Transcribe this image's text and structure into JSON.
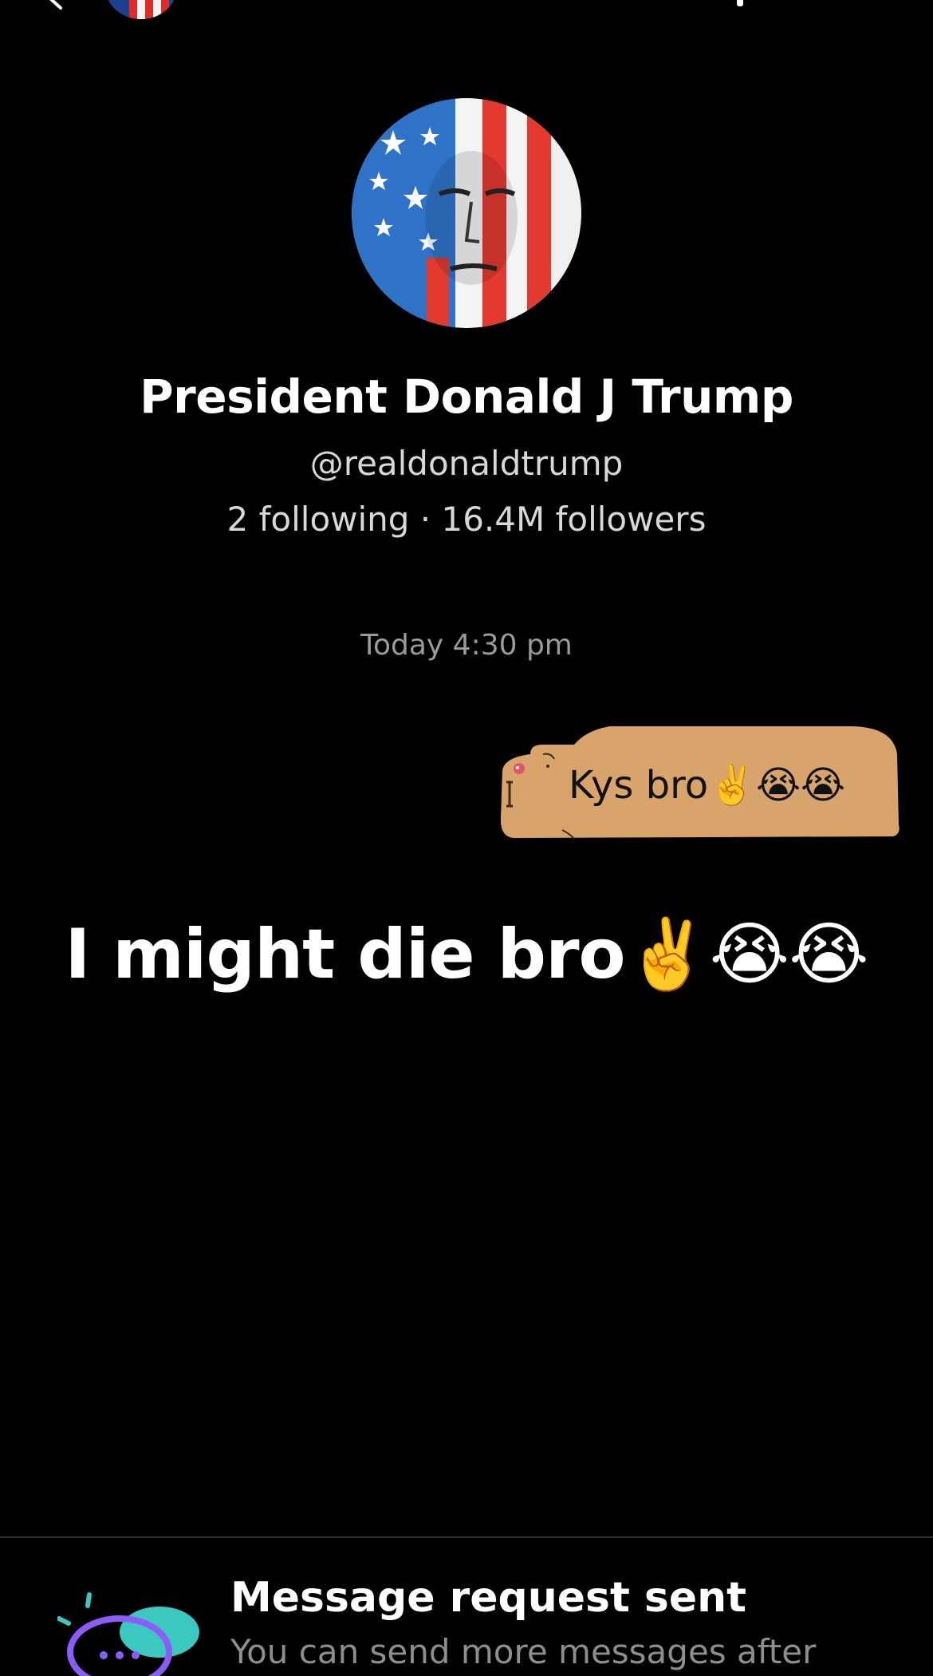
{
  "header": {
    "back_icon": "chevron-left-icon",
    "avatar_icon": "profile-avatar-icon"
  },
  "profile": {
    "name": "President Donald J Trump",
    "handle": "@realdonaldtrump",
    "stats": "2 following · 16.4M followers"
  },
  "conversation": {
    "timestamp": "Today 4:30 pm",
    "messages": [
      {
        "direction": "sent",
        "text": "Kys bro✌️😭😭"
      },
      {
        "direction": "received",
        "text": "I might die bro✌️😭😭"
      }
    ]
  },
  "request_notice": {
    "title": "Message request sent",
    "subtitle": "You can send more messages after"
  },
  "colors": {
    "background": "#000000",
    "bubble": "#D9A46B",
    "muted_text": "#8e8e8e",
    "accent_purple": "#8b5cf6",
    "accent_teal": "#3cc8c0"
  }
}
